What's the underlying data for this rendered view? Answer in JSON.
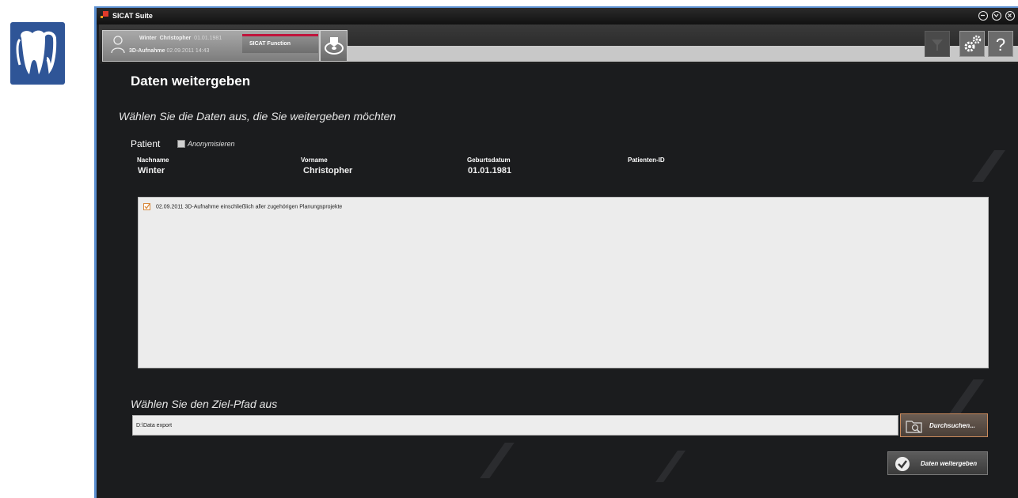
{
  "window": {
    "title": "SICAT Suite"
  },
  "patient_bar": {
    "last_name": "Winter",
    "first_name": "Christopher",
    "birth_date": "01.01.1981",
    "scan_label": "3D-Aufnahme",
    "scan_datetime": "02.09.2011 14:43",
    "function_tab_label": "SICAT Function"
  },
  "page": {
    "title": "Daten weitergeben",
    "subtitle": "Wählen Sie die Daten aus, die Sie weitergeben möchten"
  },
  "patient": {
    "section_label": "Patient",
    "anonymize_label": "Anonymisieren",
    "anonymize_checked": false,
    "columns": {
      "last_name": "Nachname",
      "first_name": "Vorname",
      "birth_date": "Geburtsdatum",
      "patient_id": "Patienten-ID"
    },
    "values": {
      "last_name": "Winter",
      "first_name": "Christopher",
      "birth_date": "01.01.1981",
      "patient_id": ""
    }
  },
  "data_list": {
    "items": [
      {
        "date": "02.09.2011",
        "label": "3D-Aufnahme",
        "description": "einschließlich aller zugehörigen Planungsprojekte",
        "checked": true
      }
    ]
  },
  "target": {
    "heading": "Wählen Sie den Ziel-Pfad aus",
    "path_value": "D:\\Data export",
    "browse_label": "Durchsuchen..."
  },
  "actions": {
    "share_label": "Daten weitergeben"
  },
  "colors": {
    "accent_red": "#c0143c",
    "window_border": "#5b8fd0",
    "logo_blue": "#2f5597",
    "background_dark": "#1b1c1e"
  },
  "icons": {
    "logo": "tooth-icon",
    "avatar": "user-icon",
    "export_tab": "export-disc-icon",
    "settings": "gear-icon",
    "help": "help-icon",
    "browse": "folder-search-icon",
    "confirm": "checkmark-icon"
  }
}
